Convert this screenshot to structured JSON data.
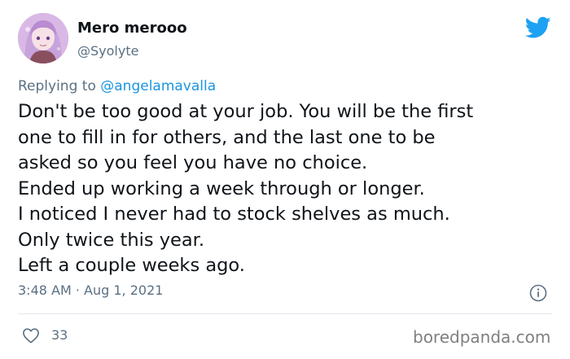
{
  "author": {
    "display_name": "Mero merooo",
    "handle": "@Syolyte"
  },
  "reply": {
    "prefix": "Replying to ",
    "mention": "@angelamavalla"
  },
  "tweet": {
    "lines": [
      "Don't be too good at your job. You will be the first",
      "one to fill in for others, and the last one to be",
      "asked so you feel you have no choice.",
      "Ended up working a week through or longer.",
      "I noticed I never had to stock shelves as much.",
      "Only twice this year.",
      "Left a couple weeks ago."
    ],
    "timestamp": "3:48 AM · Aug 1, 2021",
    "likes": "33"
  },
  "watermark": "boredpanda.com",
  "icons": {
    "brand": "twitter-bird-icon",
    "info": "info-icon",
    "like": "heart-icon"
  },
  "colors": {
    "twitter_blue": "#1da1f2",
    "mention_blue": "#1b95e0",
    "secondary_text": "#5b7083",
    "primary_text": "#0f1419"
  }
}
